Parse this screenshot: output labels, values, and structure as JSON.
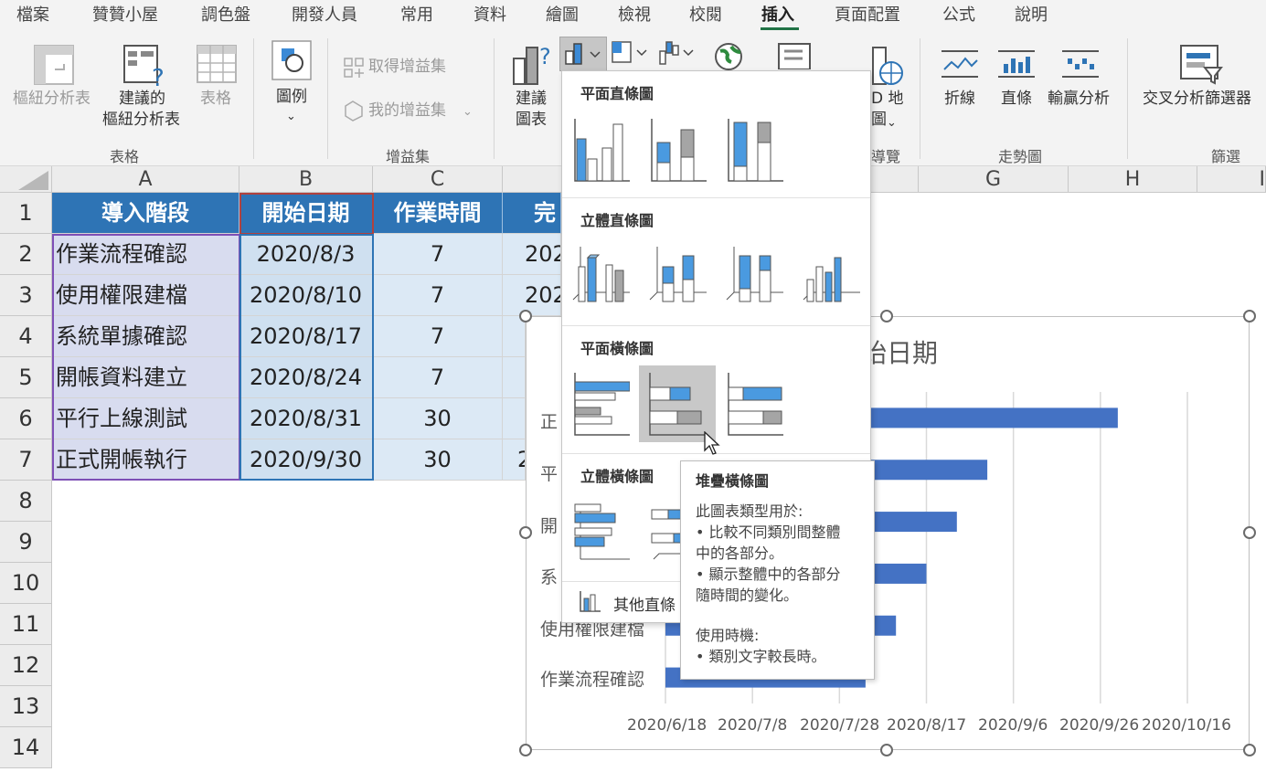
{
  "menu": {
    "tabs": [
      "檔案",
      "贊贊小屋",
      "調色盤",
      "開發人員",
      "常用",
      "資料",
      "繪圖",
      "檢視",
      "校閱",
      "插入",
      "頁面配置",
      "公式",
      "說明"
    ],
    "active": "插入"
  },
  "ribbon": {
    "pivot_table": "樞紐分析表",
    "recommended_pivot_line1": "建議的",
    "recommended_pivot_line2": "樞紐分析表",
    "table": "表格",
    "illustrations": "圖例",
    "get_addins": "取得增益集",
    "my_addins": "我的增益集",
    "recommended_chart_line1": "建議",
    "recommended_chart_line2": "圖表",
    "map3d_partial_1": "D 地",
    "map3d_partial_2": "圖",
    "sparkline_line": "折線",
    "sparkline_column": "直條",
    "sparkline_winloss": "輸贏分析",
    "slicer": "交叉分析篩選器",
    "groups": {
      "tables": "表格",
      "addins": "增益集",
      "tours_partial": "導覽",
      "sparklines": "走勢圖",
      "filters": "篩選"
    }
  },
  "grid": {
    "columns": [
      "A",
      "B",
      "C",
      "G",
      "H",
      "I"
    ],
    "rows": [
      "1",
      "2",
      "3",
      "4",
      "5",
      "6",
      "7",
      "8",
      "9",
      "10",
      "11",
      "12",
      "13",
      "14"
    ],
    "headers": {
      "a": "導入階段",
      "b": "開始日期",
      "c": "作業時間",
      "d_partial": "完"
    },
    "data": [
      {
        "a": "作業流程確認",
        "b": "2020/8/3",
        "c": "7",
        "d": "202"
      },
      {
        "a": "使用權限建檔",
        "b": "2020/8/10",
        "c": "7",
        "d": "202"
      },
      {
        "a": "系統單據確認",
        "b": "2020/8/17",
        "c": "7",
        "d": ""
      },
      {
        "a": "開帳資料建立",
        "b": "2020/8/24",
        "c": "7",
        "d": ""
      },
      {
        "a": "平行上線測試",
        "b": "2020/8/31",
        "c": "30",
        "d": ""
      },
      {
        "a": "正式開帳執行",
        "b": "2020/9/30",
        "c": "30",
        "d": "2"
      }
    ]
  },
  "chart": {
    "title_partial": "始日期",
    "visible_category_labels": [
      "作業流程確認",
      "使用權限建檔",
      "系",
      "開",
      "平",
      "正"
    ],
    "colors": {
      "bar": "#4472c4",
      "gridline": "#d9d9d9"
    }
  },
  "chart_data": {
    "type": "bar",
    "orientation": "horizontal",
    "title": "開始日期",
    "categories": [
      "作業流程確認",
      "使用權限建檔",
      "系統單據確認",
      "開帳資料建立",
      "平行上線測試",
      "正式開帳執行"
    ],
    "series": [
      {
        "name": "開始日期",
        "values": [
          "2020/8/3",
          "2020/8/10",
          "2020/8/17",
          "2020/8/24",
          "2020/8/31",
          "2020/9/30"
        ]
      }
    ],
    "x_tick_labels": [
      "2020/6/18",
      "2020/7/8",
      "2020/7/28",
      "2020/8/17",
      "2020/9/6",
      "2020/9/26",
      "2020/10/16"
    ],
    "xlim": [
      "2020/6/18",
      "2020/10/16"
    ],
    "grid": true,
    "legend": "none"
  },
  "gallery": {
    "section_2d_column": "平面直條圖",
    "section_3d_column": "立體直條圖",
    "section_2d_bar": "平面橫條圖",
    "section_3d_bar": "立體橫條圖",
    "more_charts": "其他直條",
    "hovered": "堆疊橫條圖"
  },
  "tooltip": {
    "title": "堆疊橫條圖",
    "line1": "此圖表類型用於:",
    "line2": "• 比較不同類別間整體",
    "line3": "中的各部分。",
    "line4": "• 顯示整體中的各部分",
    "line5": "隨時間的變化。",
    "line6": "使用時機:",
    "line7": "• 類別文字較長時。"
  }
}
